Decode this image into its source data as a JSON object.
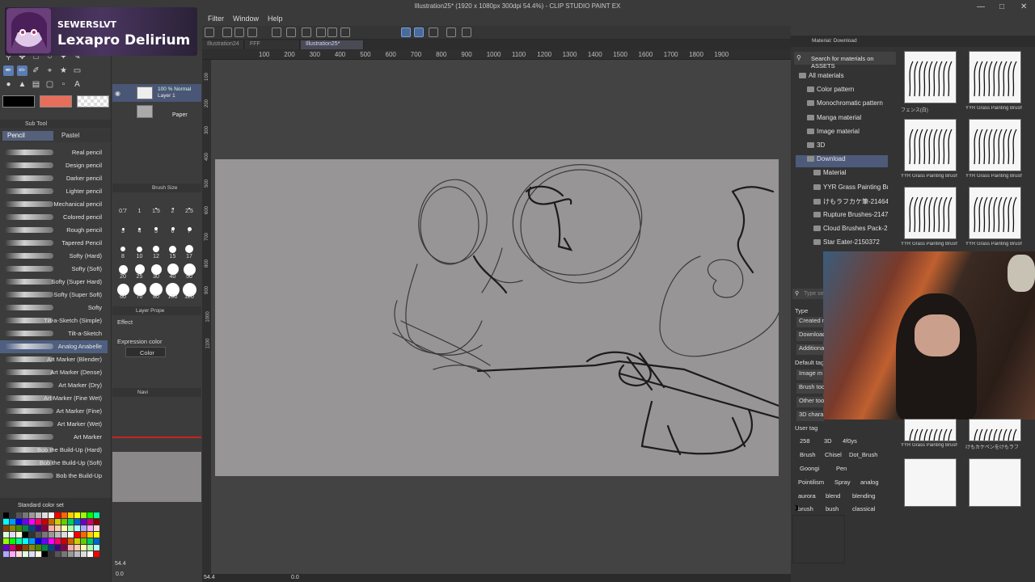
{
  "window": {
    "title": "Illustration25* (1920 x 1080px 300dpi 54.4%) - CLIP STUDIO PAINT EX",
    "menu": [
      "Filter",
      "Window",
      "Help"
    ]
  },
  "overlay": {
    "streamer_name": "SEWERSLVT",
    "stream_title": "Lexapro Delirium"
  },
  "tabs": [
    "Illustration24",
    "FFF",
    "Illustration25*"
  ],
  "ruler": {
    "top_ticks": [
      "100",
      "200",
      "300",
      "400",
      "500",
      "600",
      "700",
      "800",
      "900",
      "1000",
      "1100",
      "1200",
      "1300",
      "1400",
      "1500",
      "1600",
      "1700",
      "1800",
      "1900"
    ],
    "left_ticks": [
      "100",
      "200",
      "300",
      "400",
      "500",
      "600",
      "700",
      "800",
      "900",
      "1000",
      "1100"
    ]
  },
  "subtool": {
    "header": "Sub Tool",
    "tabs": [
      "Pencil",
      "Pastel"
    ],
    "brushes": [
      "Real pencil",
      "Design pencil",
      "Darker pencil",
      "Lighter pencil",
      "Mechanical pencil",
      "Colored pencil",
      "Rough pencil",
      "Tapered Pencil",
      "Softy (Hard)",
      "Softy (Soft)",
      "Softy (Super Hard)",
      "Softy (Super Soft)",
      "Softy",
      "Tilt-a-Sketch (Simple)",
      "Tilt-a-Sketch",
      "Analog Anabelle",
      "Art Marker (Blender)",
      "Art Marker (Dense)",
      "Art Marker (Dry)",
      "Art Marker (Fine Wet)",
      "Art Marker (Fine)",
      "Art Marker (Wet)",
      "Art Marker",
      "Bob the Build-Up (Hard)",
      "Bob the Build-Up (Soft)",
      "Bob the Build-Up"
    ],
    "selected_index": 15
  },
  "colorset": {
    "label": "Standard color set",
    "main_color": "#000000",
    "sub_color": "#e86e5c"
  },
  "layers": {
    "blend": "100 % Normal",
    "layer1": "Layer 1",
    "paper": "Paper"
  },
  "brush_size": {
    "header": "Brush Size",
    "values": [
      "0.7",
      "1",
      "1.5",
      "2",
      "2.5",
      "3",
      "4",
      "5",
      "6",
      "7",
      "8",
      "10",
      "12",
      "15",
      "17",
      "20",
      "25",
      "30",
      "40",
      "50",
      "60",
      "70",
      "80",
      "100",
      "120"
    ]
  },
  "layer_property": {
    "header": "Layer Prope",
    "effect": "Effect",
    "expression_color": "Expression color",
    "color_value": "Color"
  },
  "navigator": {
    "header": "Navi",
    "zoom": "54.4",
    "rotation": "0.0"
  },
  "material": {
    "panel_title": "Material: Download",
    "search_placeholder": "Search for materials on ASSETS",
    "tree": [
      "All materials",
      "Color pattern",
      "Monochromatic pattern",
      "Manga material",
      "Image material",
      "3D",
      "Download",
      "Material",
      "YYR Grass Painting Brush",
      "けもラフカケ筆-2146456",
      "Rupture Brushes-2147968",
      "Cloud Brushes Pack-2145",
      "Star Eater-2150372"
    ],
    "selected_tree": "Download",
    "thumbnails": [
      {
        "caption": "フェンス(白)"
      },
      {
        "caption": "YYR Grass Painting Brushes"
      },
      {
        "caption": "YYR Grass Painting Brushes"
      },
      {
        "caption": "YYR Grass Painting Brushes"
      },
      {
        "caption": "YYR Grass Painting Brushes"
      },
      {
        "caption": "YYR Grass Painting Brushes"
      },
      {
        "caption": "YYR Grass Painting Brushes"
      },
      {
        "caption": "けもカケペンをけもラフ"
      }
    ],
    "search2_placeholder": "Type se",
    "type_label": "Type",
    "type_buttons": [
      "Created m",
      "Download",
      "Additiona"
    ],
    "default_tag_label": "Default tag",
    "default_tags": [
      "Image m",
      "Brush tool",
      "Other tool",
      "3D chara"
    ],
    "user_tag_label": "User tag",
    "user_tags": [
      "258",
      "3D",
      "4f0ys",
      "Brush",
      "Chisel",
      "Dot_Brush",
      "Goongi",
      "Pen",
      "Pointilism",
      "Spray",
      "analog",
      "aurora",
      "blend",
      "blending",
      "brush",
      "bush",
      "classical"
    ]
  }
}
